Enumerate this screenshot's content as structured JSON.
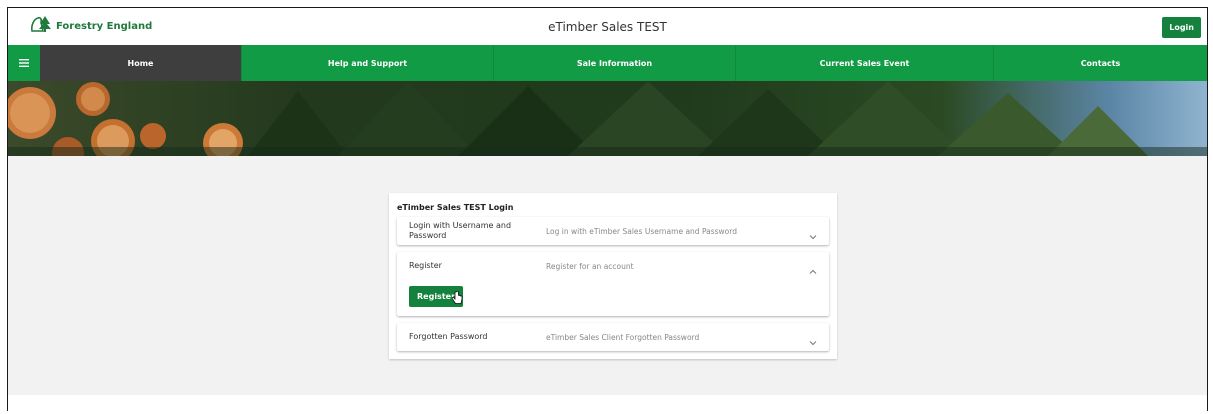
{
  "header": {
    "brand": "Forestry England",
    "title": "eTimber Sales TEST",
    "login_label": "Login"
  },
  "nav": {
    "items": [
      {
        "label": "Home",
        "active": true
      },
      {
        "label": "Help and Support"
      },
      {
        "label": "Sale Information"
      },
      {
        "label": "Current Sales Event"
      },
      {
        "label": "Contacts"
      }
    ]
  },
  "login_card": {
    "title": "eTimber Sales TEST Login",
    "panels": [
      {
        "label": "Login with Username and Password",
        "description": "Log in with eTimber Sales Username and Password",
        "expanded": false
      },
      {
        "label": "Register",
        "description": "Register for an account",
        "expanded": true,
        "button_label": "Register"
      },
      {
        "label": "Forgotten Password",
        "description": "eTimber Sales Client Forgotten Password",
        "expanded": false
      }
    ]
  },
  "colors": {
    "brand_green": "#14823c",
    "nav_green": "#119b45",
    "nav_active": "#3e3e3e"
  },
  "icons": [
    "tree-logo-icon",
    "hamburger-menu-icon",
    "chevron-down-icon",
    "chevron-up-icon",
    "hand-cursor-icon"
  ]
}
